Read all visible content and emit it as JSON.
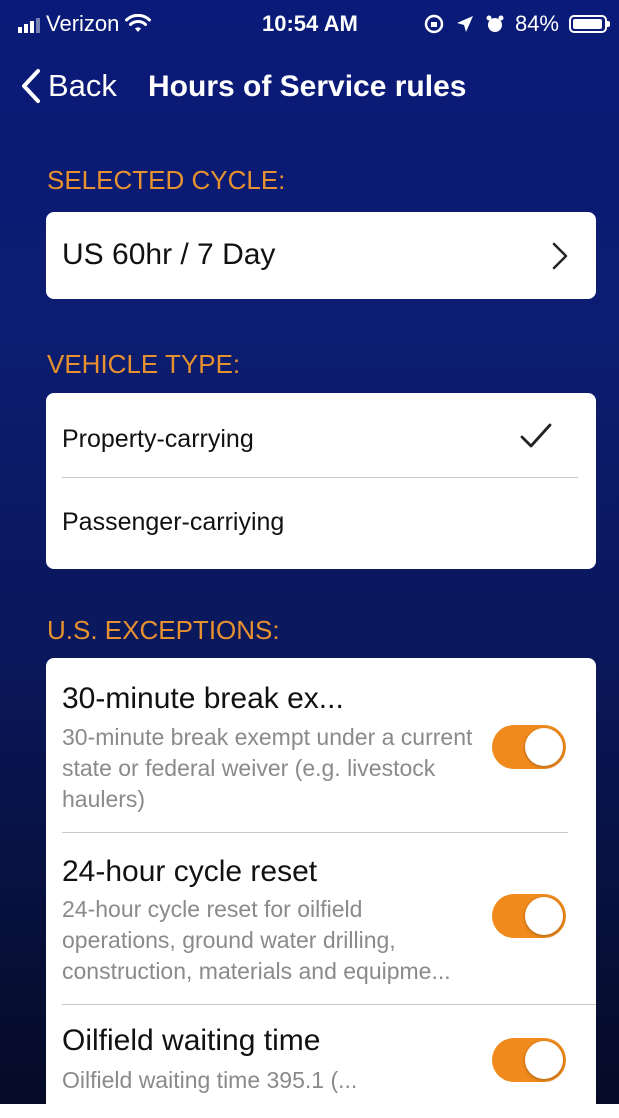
{
  "status_bar": {
    "carrier": "Verizon",
    "time": "10:54 AM",
    "battery": "84%"
  },
  "nav": {
    "back_label": "Back",
    "title": "Hours of Service rules"
  },
  "selected_cycle": {
    "section_label": "SELECTED CYCLE:",
    "value": "US 60hr / 7 Day"
  },
  "vehicle_type": {
    "section_label": "VEHICLE TYPE:",
    "options": [
      {
        "label": "Property-carrying",
        "selected": true
      },
      {
        "label": "Passenger-carriying",
        "selected": false
      }
    ]
  },
  "exceptions": {
    "section_label": "U.S. EXCEPTIONS:",
    "items": [
      {
        "title": "30-minute break ex...",
        "description": "30-minute break exempt under a current state or federal weiver (e.g. livestock haulers)",
        "enabled": true
      },
      {
        "title": "24-hour cycle reset",
        "description": "24-hour cycle reset for oilfield operations, ground water drilling, construction, materials and equipme...",
        "enabled": true
      },
      {
        "title": "Oilfield waiting time",
        "description": "Oilfield waiting time 395.1 (...",
        "enabled": true
      }
    ]
  },
  "colors": {
    "accent": "#e8912f",
    "toggle_on": "#f08a1c",
    "background_top": "#0a1a78",
    "background_bottom": "#050b26"
  }
}
